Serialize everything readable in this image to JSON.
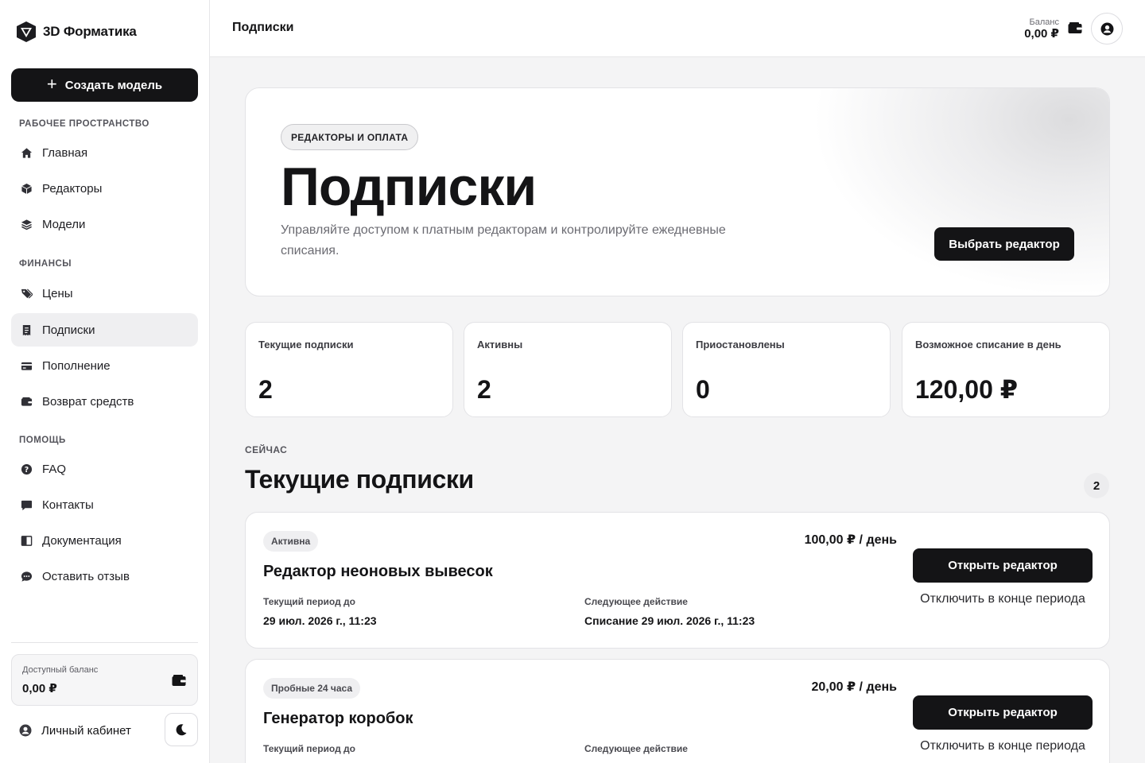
{
  "brand": {
    "name": "3D Форматика"
  },
  "sidebar": {
    "create_label": "Создать модель",
    "sections": {
      "workspace": "РАБОЧЕЕ ПРОСТРАНСТВО",
      "finance": "ФИНАНСЫ",
      "help": "ПОМОЩЬ"
    },
    "items": [
      {
        "label": "Главная",
        "icon": "home-icon"
      },
      {
        "label": "Редакторы",
        "icon": "cube-icon"
      },
      {
        "label": "Модели",
        "icon": "layers-icon"
      },
      {
        "label": "Цены",
        "icon": "tags-icon"
      },
      {
        "label": "Подписки",
        "icon": "receipt-icon",
        "active": true
      },
      {
        "label": "Пополнение",
        "icon": "credit-card-icon"
      },
      {
        "label": "Возврат средств",
        "icon": "wallet-icon"
      },
      {
        "label": "FAQ",
        "icon": "question-circle-icon"
      },
      {
        "label": "Контакты",
        "icon": "chat-bubble-icon"
      },
      {
        "label": "Документация",
        "icon": "book-icon"
      },
      {
        "label": "Оставить отзыв",
        "icon": "comment-dots-icon"
      }
    ],
    "balance": {
      "label": "Доступный баланс",
      "value": "0,00 ₽"
    },
    "cabinet_label": "Личный кабинет"
  },
  "topbar": {
    "title": "Подписки",
    "balance_label": "Баланс",
    "balance_value": "0,00 ₽"
  },
  "hero": {
    "pill": "РЕДАКТОРЫ И ОПЛАТА",
    "title": "Подписки",
    "description": "Управляйте доступом к платным редакторам и контролируйте ежедневные списания.",
    "button": "Выбрать редактор"
  },
  "stats": [
    {
      "label": "Текущие подписки",
      "value": "2"
    },
    {
      "label": "Активны",
      "value": "2"
    },
    {
      "label": "Приостановлены",
      "value": "0"
    },
    {
      "label": "Возможное списание в день",
      "value": "120,00 ₽"
    }
  ],
  "current": {
    "eyebrow": "СЕЙЧАС",
    "title": "Текущие подписки",
    "count": "2",
    "subscriptions": [
      {
        "badge": "Активна",
        "name": "Редактор неоновых вывесок",
        "price": "100,00 ₽ / день",
        "period_label": "Текущий период до",
        "period_value": "29 июл. 2026 г., 11:23",
        "next_label": "Следующее действие",
        "next_value": "Списание 29 июл. 2026 г., 11:23",
        "open_label": "Открыть редактор",
        "cancel_label": "Отключить в конце периода"
      },
      {
        "badge": "Пробные 24 часа",
        "name": "Генератор коробок",
        "price": "20,00 ₽ / день",
        "period_label": "Текущий период до",
        "period_value": "",
        "next_label": "Следующее действие",
        "next_value": "",
        "open_label": "Открыть редактор",
        "cancel_label": "Отключить в конце периода"
      }
    ]
  }
}
